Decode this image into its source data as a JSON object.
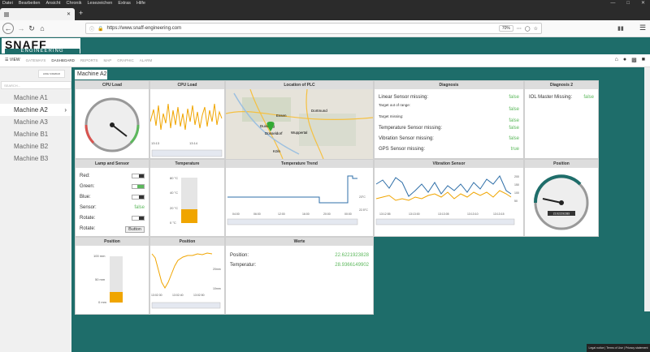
{
  "menu": [
    "Datei",
    "Bearbeiten",
    "Ansicht",
    "Chronik",
    "Lesezeichen",
    "Extras",
    "Hilfe"
  ],
  "browser": {
    "url": "https://www.snaff-engineering.com",
    "zoom": "70%"
  },
  "logo": {
    "top": "SNAFF",
    "bottom": "ENGINEERING"
  },
  "nav": {
    "view": "VIEW",
    "items": [
      "GATEWAYS",
      "DASHBOARD",
      "REPORTS",
      "MAP",
      "GRAPHIC",
      "ALARM"
    ],
    "active": "DASHBOARD"
  },
  "sidebar": {
    "hide": "HIDE SIDEBAR",
    "search": "SEARCH...",
    "machines": [
      "Machine A1",
      "Machine A2",
      "Machine A3",
      "Machine B1",
      "Machine B2",
      "Machine B3"
    ],
    "selected": "Machine A2"
  },
  "breadcrumb": "Machine A2",
  "panels": {
    "cpu_load": "CPU Load",
    "cpu_load2": "CPU Load",
    "location": "Location of PLC",
    "diagnosis": "Diagnosis",
    "diagnosis2": "Diagnosis 2",
    "lamp": "Lamp and Sensor",
    "temperature": "Temperature",
    "temp_trend": "Temperature Trend",
    "vibration": "Vibration Sensor",
    "position": "Position",
    "position2": "Position",
    "position3": "Position",
    "werte": "Werte"
  },
  "diagnosis": [
    {
      "label": "Linear Sensor missing:",
      "value": "false"
    },
    {
      "label": "Target out of range:",
      "value": "false"
    },
    {
      "label": "Target missing:",
      "value": "false"
    },
    {
      "label": "Temperature Sensor missing:",
      "value": "false"
    },
    {
      "label": "Vibration Sensor missing:",
      "value": "false"
    },
    {
      "label": "GPS Sensor missing:",
      "value": "true"
    }
  ],
  "diagnosis2": {
    "label": "IOL Master Missing:",
    "value": "false"
  },
  "lamp": {
    "red": "Red:",
    "green": "Green:",
    "blue": "Blue:",
    "sensor": "Sensor:",
    "sensor_val": "false",
    "rotate": "Rotate:",
    "rotate2": "Rotate:",
    "button": "Button"
  },
  "temperature": {
    "ticks": [
      "80 °C",
      "40 °C",
      "20 °C",
      "0 °C"
    ],
    "level": 0.3
  },
  "position_bar": {
    "ticks": [
      "100 mm",
      "50 mm",
      "0 mm"
    ],
    "level": 0.22
  },
  "werte": {
    "pos_label": "Position:",
    "pos_val": "22.6221923828",
    "temp_label": "Temperatur:",
    "temp_val": "28.9366149902"
  },
  "map": {
    "cities": [
      "Essen",
      "Dortmund",
      "Duisburg",
      "Düsseldorf",
      "Wuppertal",
      "Köln"
    ]
  },
  "cpu_time": {
    "t1": "13:13",
    "t2": "13:14"
  },
  "trend": {
    "x": [
      "04:00",
      "06:00",
      "12:00",
      "16:00",
      "20:00",
      "00:00"
    ],
    "y": [
      "23°C",
      "22.5°C"
    ]
  },
  "vib": {
    "x": [
      "13:12:55",
      "13:13:00",
      "13:13:05",
      "13:13:10",
      "13:13:15"
    ],
    "y": [
      "200",
      "150",
      "100",
      "50"
    ]
  },
  "pos_line": {
    "x": [
      "13:02:30",
      "13:02:40",
      "13:02:50"
    ],
    "y": [
      "20mm",
      "10mm"
    ]
  },
  "gauge_pos": {
    "readout": "22.622192383"
  },
  "footer": "Legal notice | Terms of Use | Privacy statement",
  "colors": {
    "teal": "#1e6d6a",
    "green": "#5cb85c",
    "amber": "#f0a500"
  }
}
